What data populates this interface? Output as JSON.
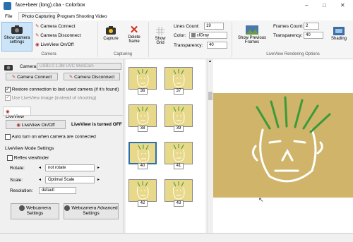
{
  "window": {
    "title": "face+beer (long).cba - Colorbox",
    "min": "–",
    "max": "□",
    "close": "✕"
  },
  "tabs": [
    {
      "label": "File",
      "active": false
    },
    {
      "label": "Photo Capturing",
      "active": true
    },
    {
      "label": "Program Shooting",
      "active": false
    },
    {
      "label": "Video",
      "active": false
    }
  ],
  "ribbon": {
    "camera_group": {
      "show_settings": "Show camera settings",
      "connect": "Camera Connect",
      "disconnect": "Camera Disconnect",
      "liveview": "LiveView On/Off",
      "label": "Camera"
    },
    "capturing_group": {
      "capture": "Capture",
      "delete": "Delete frame",
      "label": "Capturing"
    },
    "show_grid": "Show Grid",
    "lines_count_label": "Lines Count:",
    "lines_count": "19",
    "color_label": "Color:",
    "color_value": "clGray",
    "transparency_label": "Transparency:",
    "transparency_value": "40",
    "show_prev": "Show Previous Frames",
    "frames_count_label": "Frames Count:",
    "frames_count": "2",
    "transparency2_label": "Transparency:",
    "transparency2_value": "40",
    "shading": "Shading",
    "liveview_group_label": "LiveView Rendering Options"
  },
  "left": {
    "camera_label": "Camera:",
    "camera_value": "USB2.0 1.3M UVC WebCam",
    "connect": "Camera Connect",
    "disconnect": "Camera Disconnect",
    "restore": "Restore connection to last used camera (if it's found)",
    "use_liveview": "Use LiveView image (instead of shooting)",
    "liveview_tab": "LiveView",
    "liveview_btn": "LiveView On/Off",
    "liveview_status": "LiveView is turned OFF",
    "auto_turn": "Auto turn on when camera are connected",
    "mode_settings": "LiveView Mode Settings",
    "reflex": "Reflex viewfinder",
    "rotate_label": "Rotate:",
    "rotate_value": "not rotate",
    "scale_label": "Scale:",
    "scale_value": "Optimal Scale",
    "resolution_label": "Resolution:",
    "resolution_value": "default",
    "webcam_settings": "Webcamera Settings",
    "webcam_adv": "Webcamera Advanced Settings"
  },
  "thumbs": [
    "36",
    "37",
    "38",
    "39",
    "40",
    "41",
    "42",
    "43"
  ],
  "colors": {
    "accent": "#2a6fb0",
    "panel": "#f0f0f0",
    "thumb_bg": "#e8d889",
    "preview_bg": "#cfb46a"
  }
}
